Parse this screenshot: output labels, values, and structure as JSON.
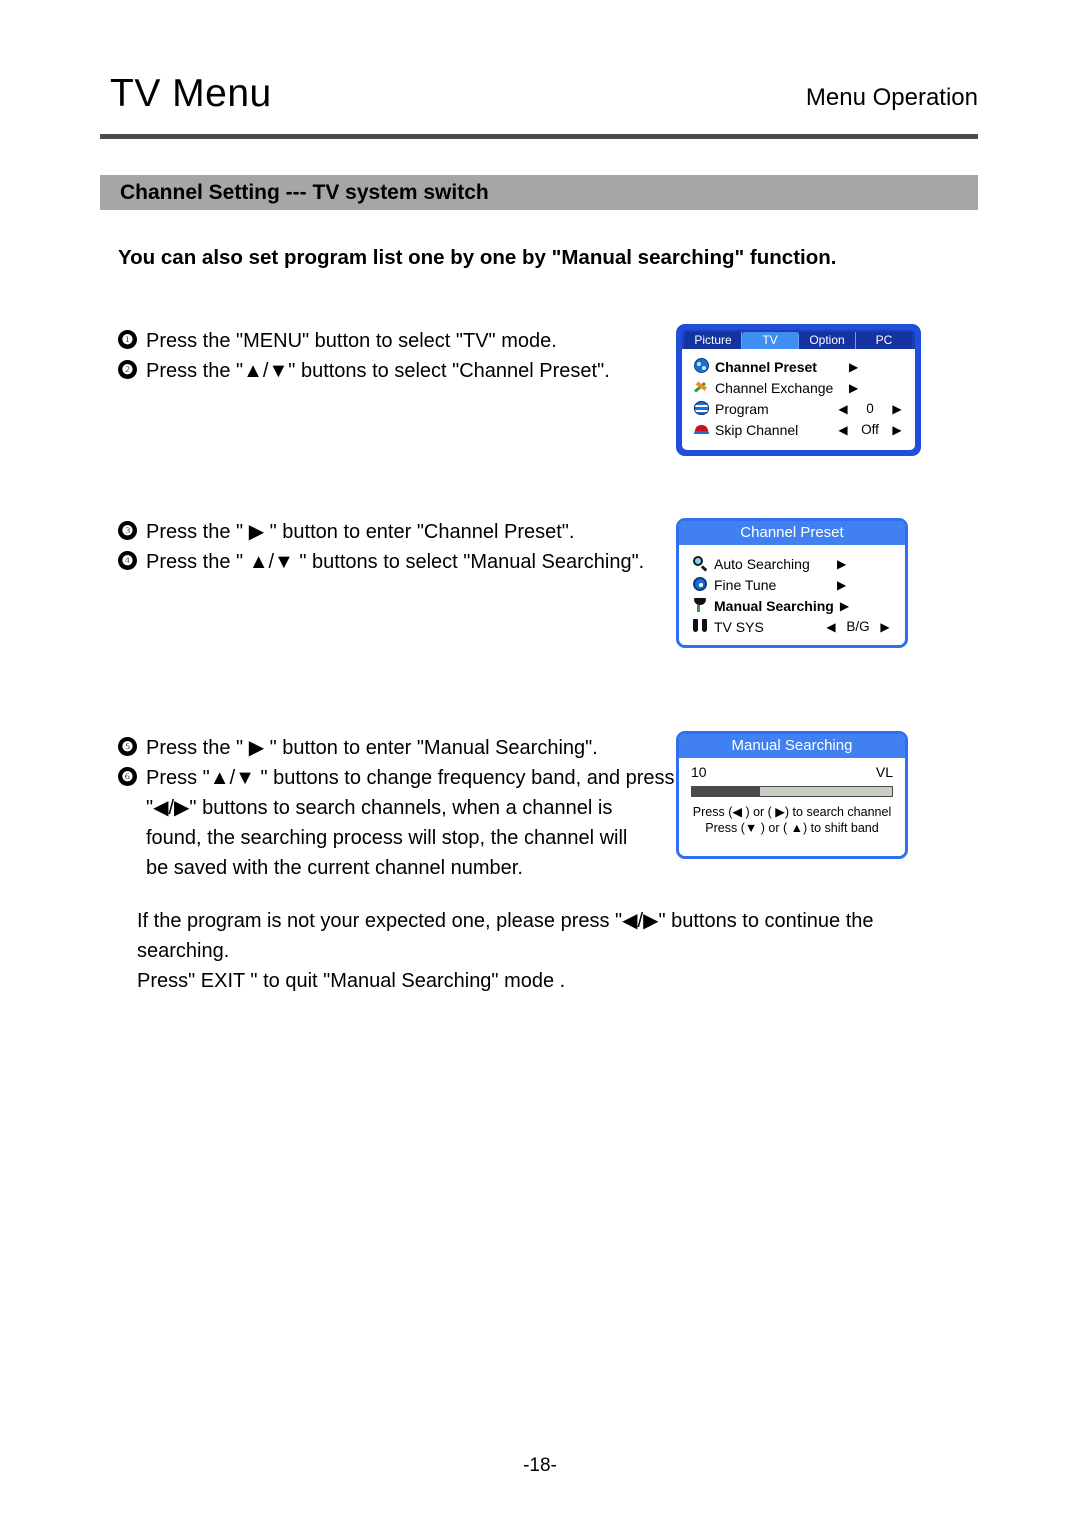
{
  "header": {
    "title": "TV Menu",
    "subtitle": "Menu Operation"
  },
  "section": {
    "title": "Channel Setting --- TV system switch"
  },
  "lead": "You can also set program list one by one by \"Manual searching\" function.",
  "steps": {
    "block1": [
      {
        "num": "❶",
        "text": "Press the \"MENU\" button to select \"TV\" mode."
      },
      {
        "num": "❷",
        "text": "Press the \"▲/▼\" buttons to select \"Channel Preset\"."
      }
    ],
    "block2": [
      {
        "num": "❸",
        "text": "Press the \" ▶ \" button to enter \"Channel Preset\"."
      },
      {
        "num": "❹",
        "text": "Press the \" ▲/▼ \" buttons to select \"Manual Searching\"."
      }
    ],
    "block3": [
      {
        "num": "❺",
        "text": "Press the \" ▶ \" button to enter \"Manual Searching\"."
      },
      {
        "num": "❻",
        "text": "Press \"▲/▼ \" buttons to change frequency band, and press",
        "lines": [
          "\"◀/▶\" buttons to search channels, when a channel is",
          "found, the searching process will stop, the channel will",
          "be saved with the current channel number."
        ]
      }
    ],
    "block4": [
      "If the program is not your expected one, please press \"◀/▶\" buttons to continue the",
      "searching.",
      "Press\" EXIT \" to quit \"Manual Searching\" mode ."
    ]
  },
  "osd_tv_menu": {
    "tabs": [
      {
        "label": "Picture",
        "active": false
      },
      {
        "label": "TV",
        "active": true
      },
      {
        "label": "Option",
        "active": false
      },
      {
        "label": "PC",
        "active": false
      }
    ],
    "rows": [
      {
        "icon": "channel-preset-icon",
        "label": "Channel Preset",
        "bold": true,
        "left_arrow": "",
        "value": "",
        "right_arrow": "▶"
      },
      {
        "icon": "channel-exchange-icon",
        "label": "Channel Exchange",
        "bold": false,
        "left_arrow": "",
        "value": "",
        "right_arrow": "▶"
      },
      {
        "icon": "program-icon",
        "label": "Program",
        "bold": false,
        "left_arrow": "◀",
        "value": "0",
        "right_arrow": "▶"
      },
      {
        "icon": "skip-channel-icon",
        "label": "Skip Channel",
        "bold": false,
        "left_arrow": "◀",
        "value": "Off",
        "right_arrow": "▶"
      }
    ]
  },
  "osd_channel_preset": {
    "caption": "Channel Preset",
    "rows": [
      {
        "icon": "auto-searching-icon",
        "label": "Auto Searching",
        "bold": false,
        "left_arrow": "",
        "value": "",
        "right_arrow": "▶"
      },
      {
        "icon": "fine-tune-icon",
        "label": "Fine Tune",
        "bold": false,
        "left_arrow": "",
        "value": "",
        "right_arrow": "▶"
      },
      {
        "icon": "manual-searching-icon",
        "label": "Manual Searching",
        "bold": true,
        "left_arrow": "",
        "value": "",
        "right_arrow": "▶"
      },
      {
        "icon": "tv-sys-icon",
        "label": "TV SYS",
        "bold": false,
        "left_arrow": "◀",
        "value": "B/G",
        "right_arrow": "▶"
      }
    ]
  },
  "osd_manual_searching": {
    "caption": "Manual Searching",
    "channel_number": "10",
    "band": "VL",
    "progress_percent": 34,
    "hints": [
      "Press (◀ ) or ( ▶) to search channel",
      "Press (▼ ) or ( ▲) to shift band"
    ]
  },
  "footer": {
    "page_number": "-18-"
  },
  "colors": {
    "section_bar": "#a6a6a6",
    "rule": "#4d4d4d",
    "osd_border": "#1f4fd8",
    "osd_caption": "#4080f0",
    "tab_active": "#3f8ff2",
    "progress_fill": "#4a4a4a",
    "progress_track": "#c7cec4"
  }
}
